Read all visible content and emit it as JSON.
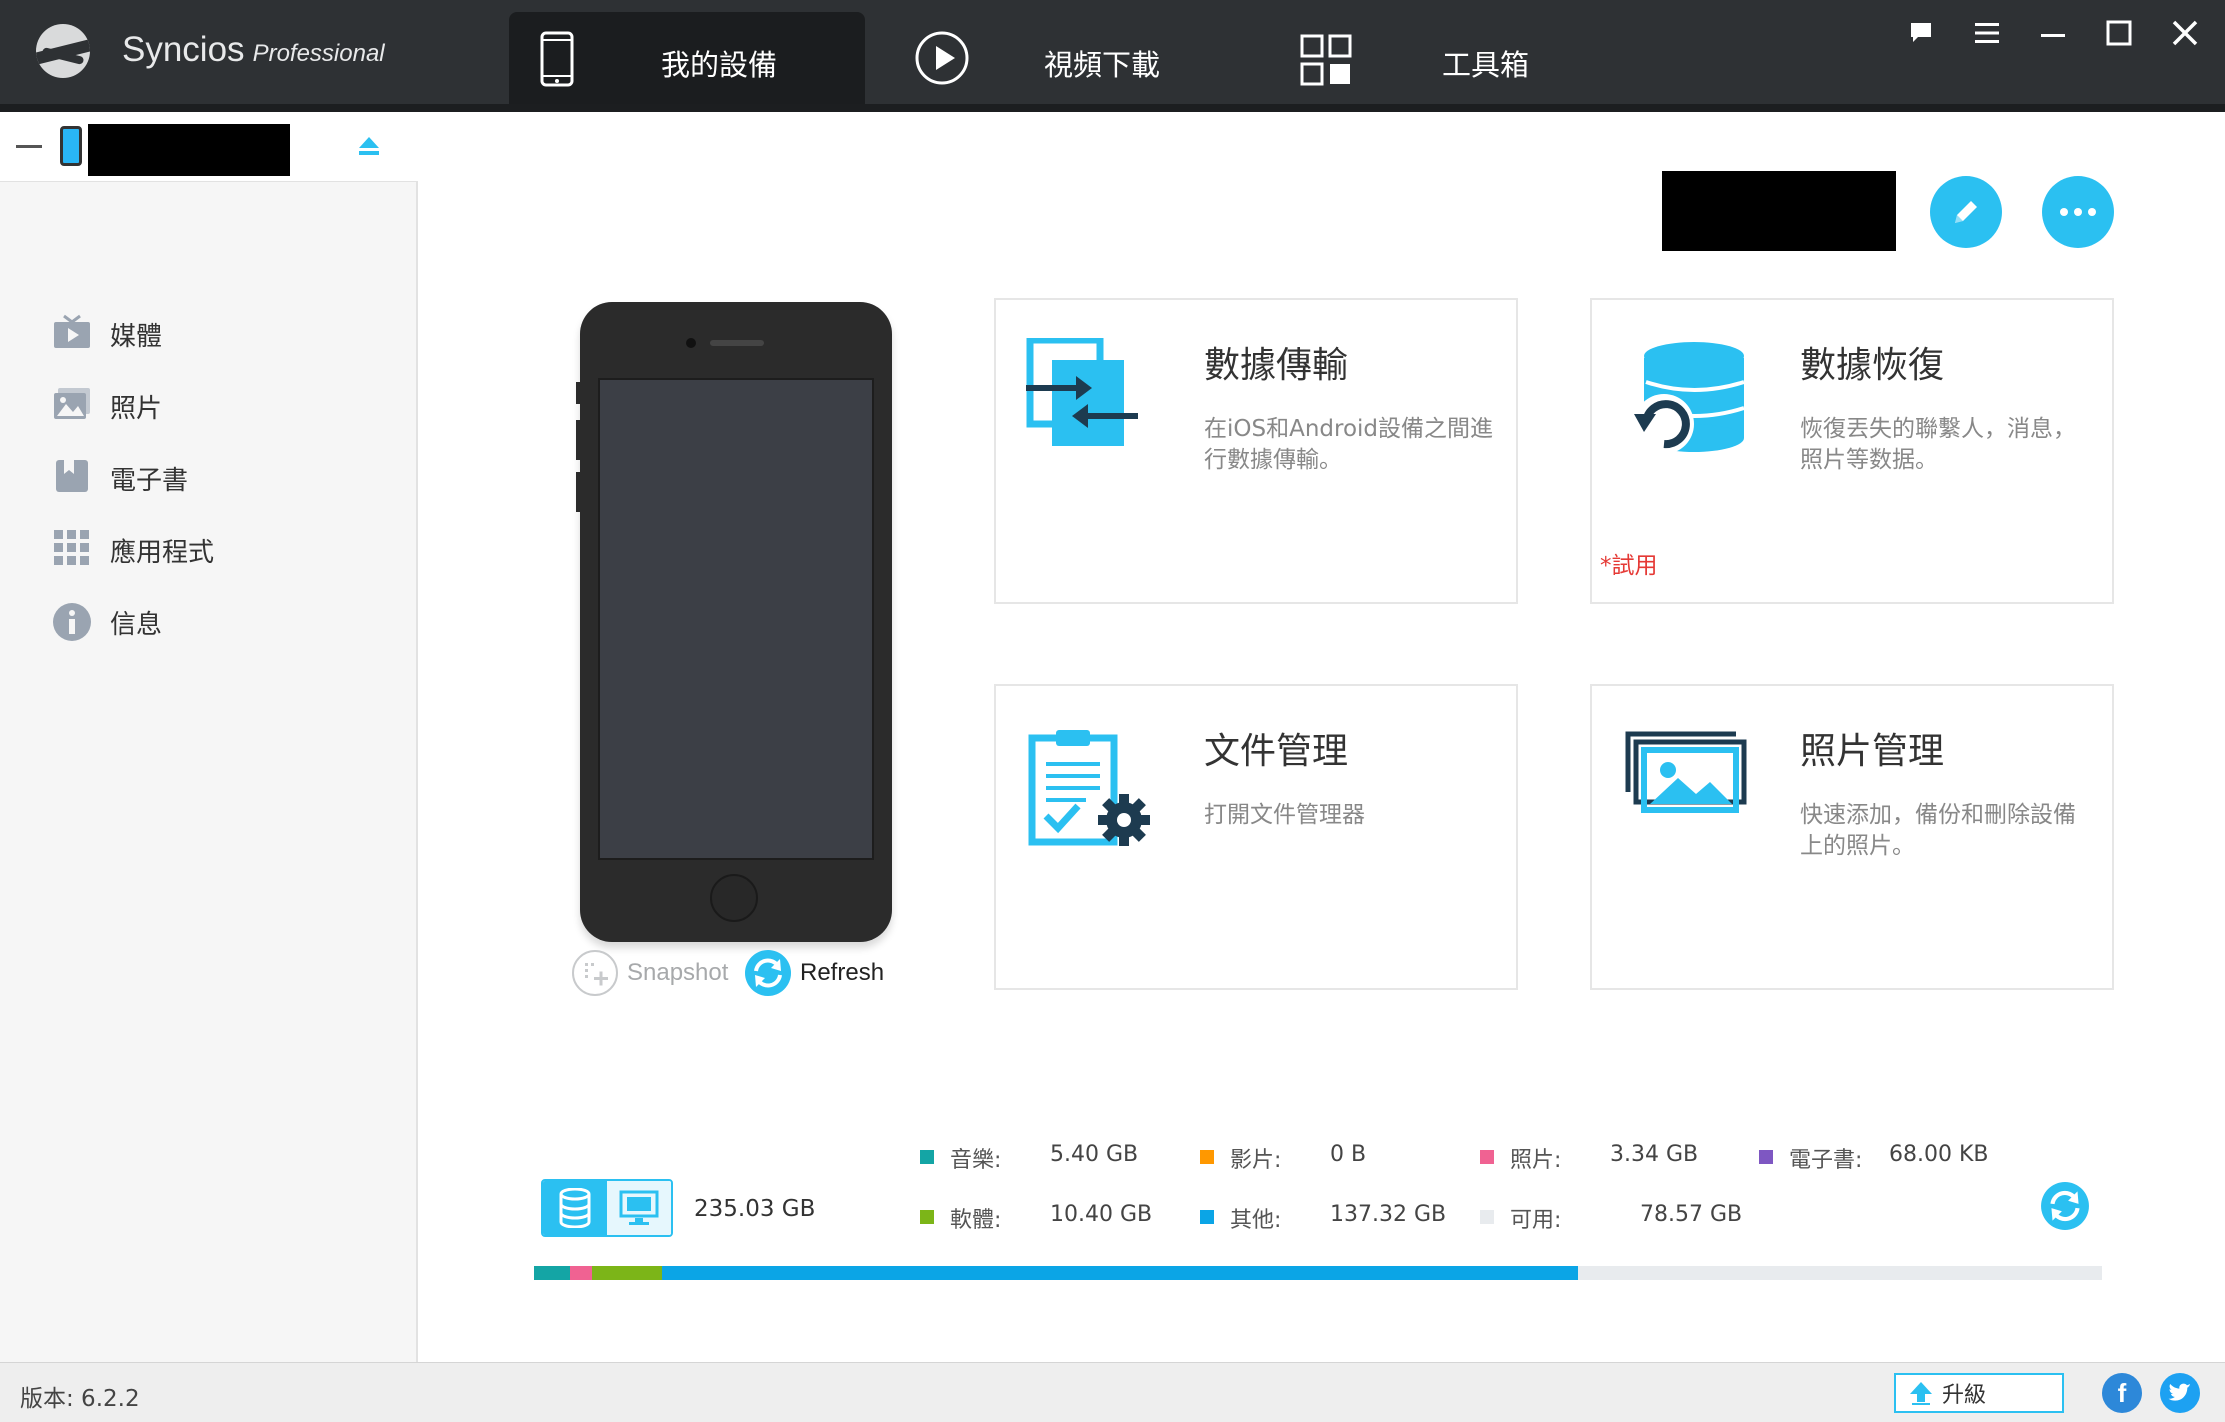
{
  "app": {
    "name": "Syncios",
    "edition": "Professional"
  },
  "tabs": [
    {
      "label": "我的設備",
      "icon": "phone-icon",
      "active": true
    },
    {
      "label": "視頻下載",
      "icon": "play-circle-icon",
      "active": false
    },
    {
      "label": "工具箱",
      "icon": "grid-icon",
      "active": false
    }
  ],
  "window_controls": [
    "chat-icon",
    "menu-icon",
    "minimize-icon",
    "maximize-icon",
    "close-icon"
  ],
  "sidebar": {
    "items": [
      {
        "label": "媒體",
        "icon": "media-icon"
      },
      {
        "label": "照片",
        "icon": "photos-icon"
      },
      {
        "label": "電子書",
        "icon": "ebook-icon"
      },
      {
        "label": "應用程式",
        "icon": "apps-icon"
      },
      {
        "label": "信息",
        "icon": "info-icon"
      }
    ]
  },
  "device": {
    "snapshot_label": "Snapshot",
    "refresh_label": "Refresh"
  },
  "cards": [
    {
      "title": "數據傳輸",
      "desc": "在iOS和Android設備之間進行數據傳輸。",
      "icon": "data-transfer-icon"
    },
    {
      "title": "數據恢復",
      "desc": "恢復丟失的聯繫人，消息，照片等数据。",
      "icon": "data-recovery-icon",
      "trial": "*試用"
    },
    {
      "title": "文件管理",
      "desc": "打開文件管理器",
      "icon": "file-manager-icon"
    },
    {
      "title": "照片管理",
      "desc": "快速添加，備份和刪除設備上的照片。",
      "icon": "photo-manager-icon"
    }
  ],
  "storage": {
    "total": "235.03 GB",
    "legend": [
      {
        "label": "音樂:",
        "value": "5.40 GB",
        "color": "#14a5a5"
      },
      {
        "label": "影片:",
        "value": "0 B",
        "color": "#ff9800"
      },
      {
        "label": "照片:",
        "value": "3.34 GB",
        "color": "#f06292"
      },
      {
        "label": "電子書:",
        "value": "68.00 KB",
        "color": "#7e57c2"
      },
      {
        "label": "軟體:",
        "value": "10.40 GB",
        "color": "#7cb518"
      },
      {
        "label": "其他:",
        "value": "137.32 GB",
        "color": "#0ba5e6"
      },
      {
        "label": "可用:",
        "value": "78.57 GB",
        "color": "#e8ebee"
      }
    ],
    "bar_segments": [
      {
        "name": "music",
        "gb": 5.4,
        "color": "#14a5a5"
      },
      {
        "name": "photos",
        "gb": 3.34,
        "color": "#f06292"
      },
      {
        "name": "software",
        "gb": 10.4,
        "color": "#7cb518"
      },
      {
        "name": "other",
        "gb": 137.32,
        "color": "#0ba5e6"
      },
      {
        "name": "free",
        "gb": 78.57,
        "color": "#e8ebee"
      }
    ]
  },
  "status": {
    "version": "版本: 6.2.2",
    "upgrade_label": "升級"
  }
}
